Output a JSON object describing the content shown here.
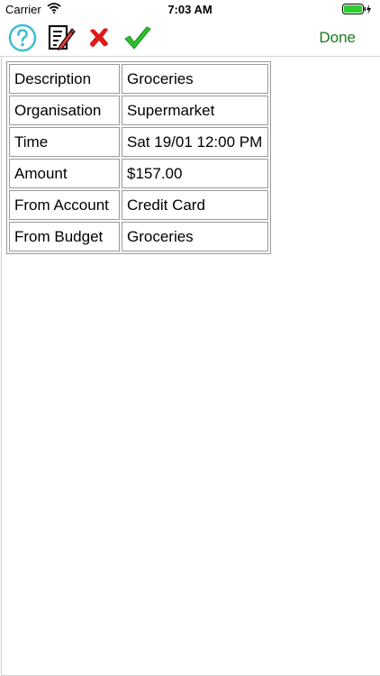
{
  "status_bar": {
    "carrier": "Carrier",
    "time": "7:03 AM"
  },
  "toolbar": {
    "done_label": "Done"
  },
  "details": {
    "rows": [
      {
        "label": "Description",
        "value": "Groceries"
      },
      {
        "label": "Organisation",
        "value": "Supermarket"
      },
      {
        "label": "Time",
        "value": "Sat 19/01 12:00 PM"
      },
      {
        "label": "Amount",
        "value": "$157.00"
      },
      {
        "label": "From Account",
        "value": "Credit Card"
      },
      {
        "label": "From Budget",
        "value": "Groceries"
      }
    ]
  },
  "colors": {
    "accent_green": "#1a7a1a",
    "help_cyan": "#3bbfd0",
    "delete_red": "#e01818"
  }
}
